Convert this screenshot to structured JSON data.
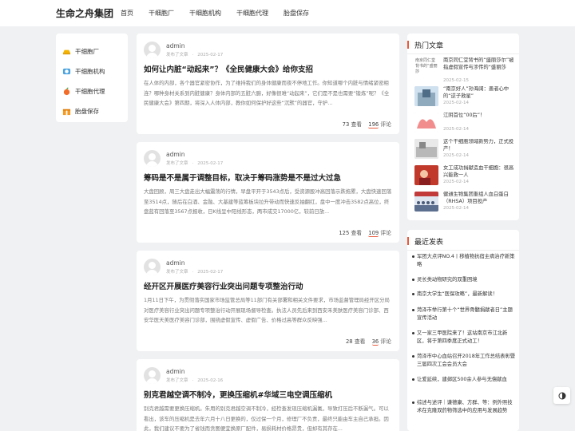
{
  "header": {
    "logo": "生命之舟集团",
    "nav": [
      "首页",
      "干细胞厂",
      "干细胞机构",
      "干细胞代理",
      "胎盘保存"
    ]
  },
  "categories": [
    {
      "label": "干细胞厂",
      "icon": "gold-ingot-icon",
      "color": "#f5b400"
    },
    {
      "label": "干细胞机构",
      "icon": "globe-icon",
      "color": "#4aa3df"
    },
    {
      "label": "干细胞代理",
      "icon": "fruit-icon",
      "color": "#f36d2a"
    },
    {
      "label": "胎盘保存",
      "icon": "gift-icon",
      "color": "#f59a23"
    }
  ],
  "posts": [
    {
      "author": "admin",
      "published": "发布了文章",
      "date": "2025-02-17",
      "title": "如何让内脏“动起来”？《全民健康大会》给你支招",
      "excerpt": "在人体的内部，各个器官紧密协作，为了维持我们的身体健康而夜不停地工作。你知道哪个内脏与情绪紧密相连？哪种身材关系到内脏健康？身体内部的五脏六腑，好像很难“动起来”，它们是不是也需要“锻炼”呢？《全民健康大会》第四期，将深入人体内部，教你如何保护好这些“沉默”的器官，守护...",
      "views": "73",
      "views_label": "查看",
      "comments": "196",
      "comments_label": "评论"
    },
    {
      "author": "admin",
      "published": "发布了文章",
      "date": "2025-02-17",
      "title": "筹码是不是属于调整目标，取决于筹码涨势是不是过大过急",
      "excerpt": "大盘回顾，周三大盘走出大幅震荡的行情，早盘平开于3543点后，受资源股冲高回落示跌拖累，大盘快速回落至3514点，随后在白酒、金融、大基建等蓝筹板块拉升带动而快速反抽翻红，盘中一度冲击3582点高位，终盘蓝有回落至3567点报收，日K线呈中阳线形态，两市成交17000亿，较前日放...",
      "views": "125",
      "views_label": "查看",
      "comments": "109",
      "comments_label": "评论"
    },
    {
      "author": "admin",
      "published": "发布了文章",
      "date": "2025-02-17",
      "title": "经开区开展医疗美容行业突出问题专项整治行动",
      "excerpt": "1月11日下午，为贯彻落实国家市场监管总局等11部门有关部署和相关文件要求，市场监督管理局经开区分局对医疗美容行业突出问题专项整治行动开展现场督导检查。执法人员先后来到西安禾美肤医疗美容门诊部、西安华医天美医疗美容门诊部，围绕虚假宣传、虚假广告、价格过高等群众反映强...",
      "views": "28",
      "views_label": "查看",
      "comments": "36",
      "comments_label": "评论"
    },
    {
      "author": "admin",
      "published": "发布了文章",
      "date": "2025-02-16",
      "title": "别克君越空调不制冷，更换压缩机#华域三电空调压缩机",
      "excerpt": "别克君越需要更换压缩机。朱用的别克君越空调不制冷，经检查发现压缩机漏氟，导致打压后不断漏气。可以看出，该车的压缩机是去年六月十八日更换的，仅过保一个月，修理厂不负责，最终只能由车主自己承担。因此，我们建议不要为了省钱而贪图便宜换原厂配件，易损耗材价格昂贵，但却有其存在...",
      "views": "",
      "views_label": "",
      "comments": "",
      "comments_label": ""
    }
  ],
  "hot": {
    "title": "热门文章",
    "items": [
      {
        "title": "南京同仁堂背书的“盛丽莎尔”被指虚假宣传与涉传的“盛丽莎",
        "date": "2025-02-15",
        "thumb_alt": "南京同仁堂背书的“盛丽莎",
        "thumb": "alt"
      },
      {
        "title": "“南京好人”孙海阔：患者心中的“逆子救星”",
        "date": "2025-02-14",
        "thumb": "photo-blue"
      },
      {
        "title": "江阴首位“00后”！",
        "date": "2025-02-14",
        "thumb": "photo-pink"
      },
      {
        "title": "这个干细胞领域新势力，正式投产！",
        "date": "2025-02-14",
        "thumb": "photo-grey"
      },
      {
        "title": "女工成功捐献造血干细胞：很高兴能救一人",
        "date": "2025-02-14",
        "thumb": "photo-red"
      },
      {
        "title": "健通生物集团重组人血白蛋白（RHSA）项目投产",
        "date": "2025-02-14",
        "thumb": "photo-crowd"
      }
    ]
  },
  "recent": {
    "title": "最近发表",
    "items": [
      "军团大点评NO.4丨移植物抗宿主病治疗新策略",
      "灵长类动物研究的双重困境",
      "南京大学生“医保攻略”，最新解读！",
      "菏泽市举行第十个“世界骨髓捐献者日”主题宣传活动",
      "又一家三甲医院来了！这站南京市江北新区，将于第四季度正式动工！",
      "菏泽市中心血站召开2018年工作总结表彰暨三届四次工会会员大会",
      "让爱延续，建邺区500余人参与无偿献血",
      "综述与述评｜谦德康、方群、等：例外照技术在克隆双药物筛选中的应用与发展趋势"
    ]
  },
  "colors": {
    "accent": "#e85b3d",
    "background": "#f0f1f3",
    "card": "#ffffff"
  }
}
